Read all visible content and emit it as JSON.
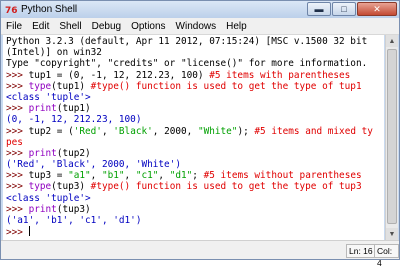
{
  "window": {
    "title": "Python Shell"
  },
  "menu": [
    "File",
    "Edit",
    "Shell",
    "Debug",
    "Options",
    "Windows",
    "Help"
  ],
  "colors": {
    "prompt": "#800000",
    "output": "#0000c0",
    "keyword": "#9000c0",
    "string": "#00a000",
    "comment": "#e00000"
  },
  "shell_lines": [
    [
      {
        "t": "Python 3.2.3 (default, Apr 11 2012, 07:15:24) [MSC v.1500 32 bit",
        "c": "plain"
      }
    ],
    [
      {
        "t": "(Intel)] on win32",
        "c": "plain"
      }
    ],
    [
      {
        "t": "Type \"copyright\", \"credits\" or \"license()\" for more information.",
        "c": "plain"
      }
    ],
    [
      {
        "t": ">>> ",
        "c": "prompt"
      },
      {
        "t": "tup1 = (0, -1, 12, 212.23, 100) ",
        "c": "plain"
      },
      {
        "t": "#5 items with parentheses",
        "c": "cmt"
      }
    ],
    [
      {
        "t": ">>> ",
        "c": "prompt"
      },
      {
        "t": "type",
        "c": "kw"
      },
      {
        "t": "(tup1) ",
        "c": "plain"
      },
      {
        "t": "#type() function is used to get the type of tup1",
        "c": "cmt"
      }
    ],
    [
      {
        "t": "<class 'tuple'>",
        "c": "stdout"
      }
    ],
    [
      {
        "t": ">>> ",
        "c": "prompt"
      },
      {
        "t": "print",
        "c": "kw"
      },
      {
        "t": "(tup1)",
        "c": "plain"
      }
    ],
    [
      {
        "t": "(0, -1, 12, 212.23, 100)",
        "c": "stdout"
      }
    ],
    [
      {
        "t": ">>> ",
        "c": "prompt"
      },
      {
        "t": "tup2 = (",
        "c": "plain"
      },
      {
        "t": "'Red'",
        "c": "str"
      },
      {
        "t": ", ",
        "c": "plain"
      },
      {
        "t": "'Black'",
        "c": "str"
      },
      {
        "t": ", 2000, ",
        "c": "plain"
      },
      {
        "t": "\"White\"",
        "c": "str"
      },
      {
        "t": "); ",
        "c": "plain"
      },
      {
        "t": "#5 items and mixed ty",
        "c": "cmt"
      }
    ],
    [
      {
        "t": "pes",
        "c": "cmt"
      }
    ],
    [
      {
        "t": ">>> ",
        "c": "prompt"
      },
      {
        "t": "print",
        "c": "kw"
      },
      {
        "t": "(tup2)",
        "c": "plain"
      }
    ],
    [
      {
        "t": "('Red', 'Black', 2000, 'White')",
        "c": "stdout"
      }
    ],
    [
      {
        "t": ">>> ",
        "c": "prompt"
      },
      {
        "t": "tup3 = ",
        "c": "plain"
      },
      {
        "t": "\"a1\"",
        "c": "str"
      },
      {
        "t": ", ",
        "c": "plain"
      },
      {
        "t": "\"b1\"",
        "c": "str"
      },
      {
        "t": ", ",
        "c": "plain"
      },
      {
        "t": "\"c1\"",
        "c": "str"
      },
      {
        "t": ", ",
        "c": "plain"
      },
      {
        "t": "\"d1\"",
        "c": "str"
      },
      {
        "t": "; ",
        "c": "plain"
      },
      {
        "t": "#5 items without parentheses",
        "c": "cmt"
      }
    ],
    [
      {
        "t": ">>> ",
        "c": "prompt"
      },
      {
        "t": "type",
        "c": "kw"
      },
      {
        "t": "(tup3) ",
        "c": "plain"
      },
      {
        "t": "#type() function is used to get the type of tup3",
        "c": "cmt"
      }
    ],
    [
      {
        "t": "<class 'tuple'>",
        "c": "stdout"
      }
    ],
    [
      {
        "t": ">>> ",
        "c": "prompt"
      },
      {
        "t": "print",
        "c": "kw"
      },
      {
        "t": "(tup3)",
        "c": "plain"
      }
    ],
    [
      {
        "t": "('a1', 'b1', 'c1', 'd1')",
        "c": "stdout"
      }
    ],
    [
      {
        "t": ">>> ",
        "c": "prompt"
      }
    ]
  ],
  "status": {
    "line": "Ln: 16",
    "col": "Col: 4"
  }
}
